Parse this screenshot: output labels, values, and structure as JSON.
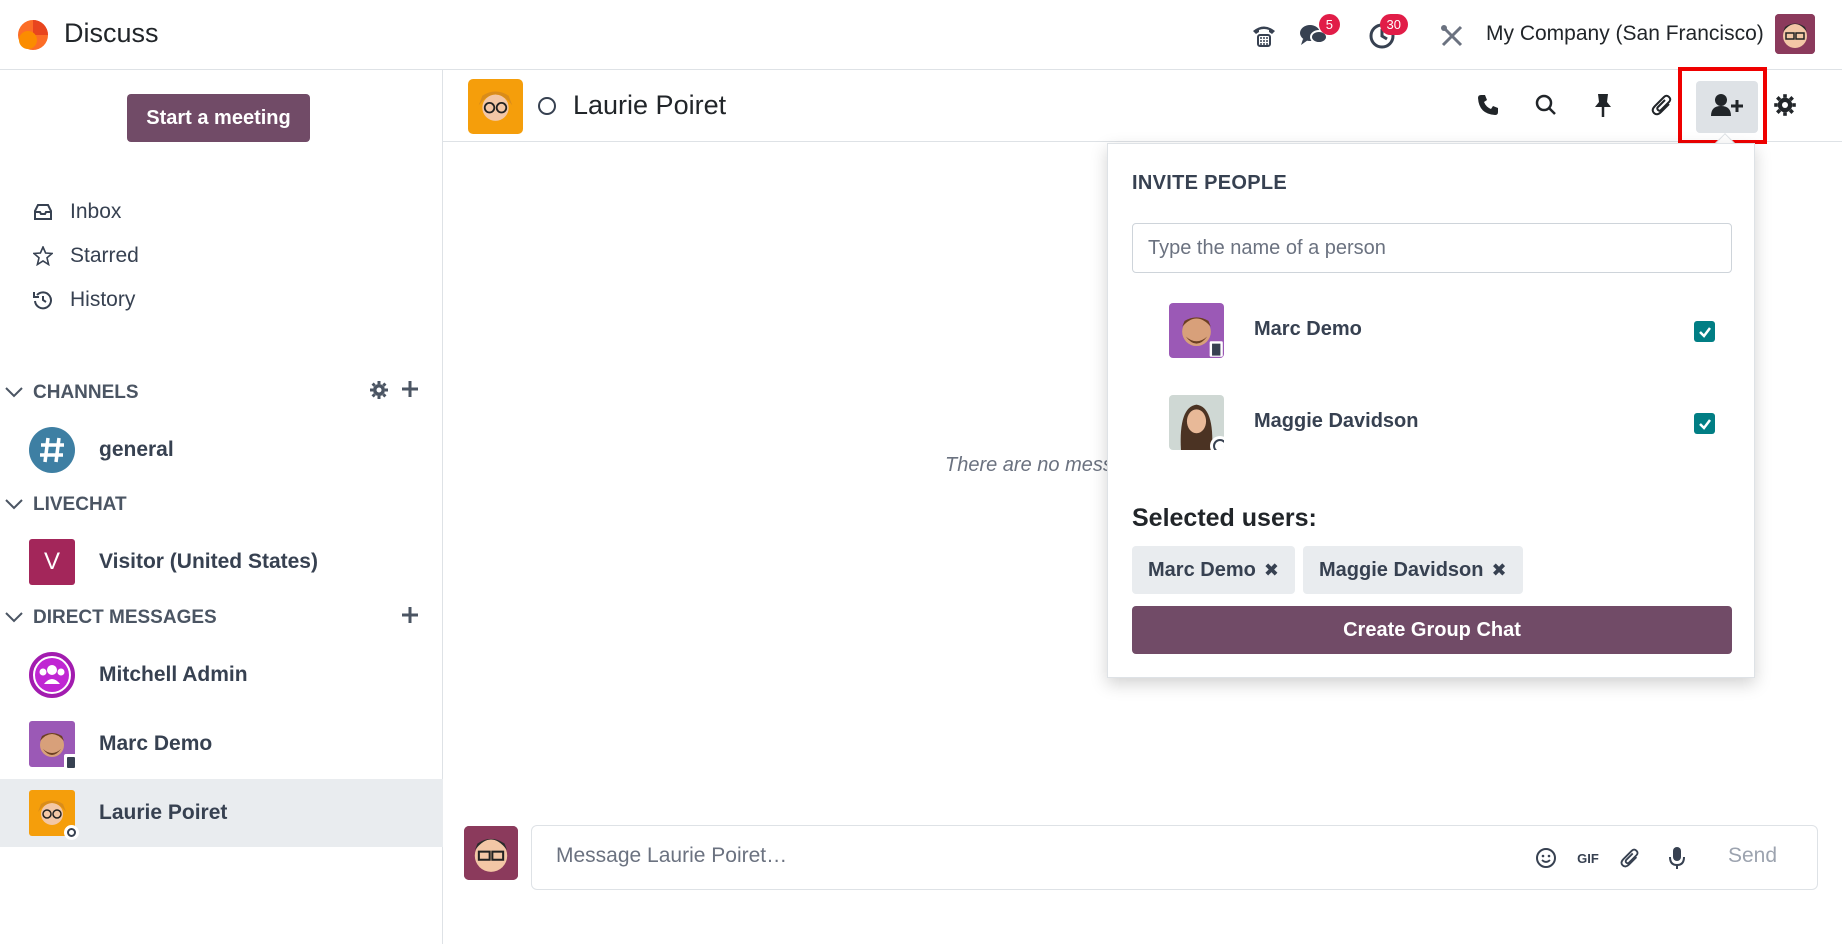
{
  "app": {
    "title": "Discuss"
  },
  "topbar": {
    "messages_badge": "5",
    "activities_badge": "30",
    "company": "My Company (San Francisco)"
  },
  "sidebar": {
    "meeting_button": "Start a meeting",
    "mailboxes": [
      {
        "label": "Inbox",
        "icon": "inbox-icon"
      },
      {
        "label": "Starred",
        "icon": "star-icon"
      },
      {
        "label": "History",
        "icon": "history-icon"
      }
    ],
    "channels_header": "CHANNELS",
    "channels": [
      {
        "label": "general",
        "icon": "hash-icon"
      }
    ],
    "livechat_header": "LIVECHAT",
    "livechats": [
      {
        "label": "Visitor (United States)",
        "initial": "V"
      }
    ],
    "dm_header": "DIRECT MESSAGES",
    "direct_messages": [
      {
        "label": "Mitchell Admin"
      },
      {
        "label": "Marc Demo"
      },
      {
        "label": "Laurie Poiret"
      }
    ]
  },
  "thread": {
    "name": "Laurie Poiret",
    "empty_text": "There are no mess",
    "composer_placeholder": "Message Laurie Poiret…",
    "gif_label": "GIF",
    "send_label": "Send"
  },
  "invite": {
    "title": "INVITE PEOPLE",
    "search_placeholder": "Type the name of a person",
    "users": [
      {
        "name": "Marc Demo",
        "checked": true
      },
      {
        "name": "Maggie Davidson",
        "checked": true
      }
    ],
    "selected_label": "Selected users:",
    "chips": [
      "Marc Demo",
      "Maggie Davidson"
    ],
    "create_button": "Create Group Chat"
  },
  "colors": {
    "brand": "#714b67",
    "checkbox": "#017e84",
    "badge": "#e11d48",
    "highlight": "#ef0000"
  }
}
